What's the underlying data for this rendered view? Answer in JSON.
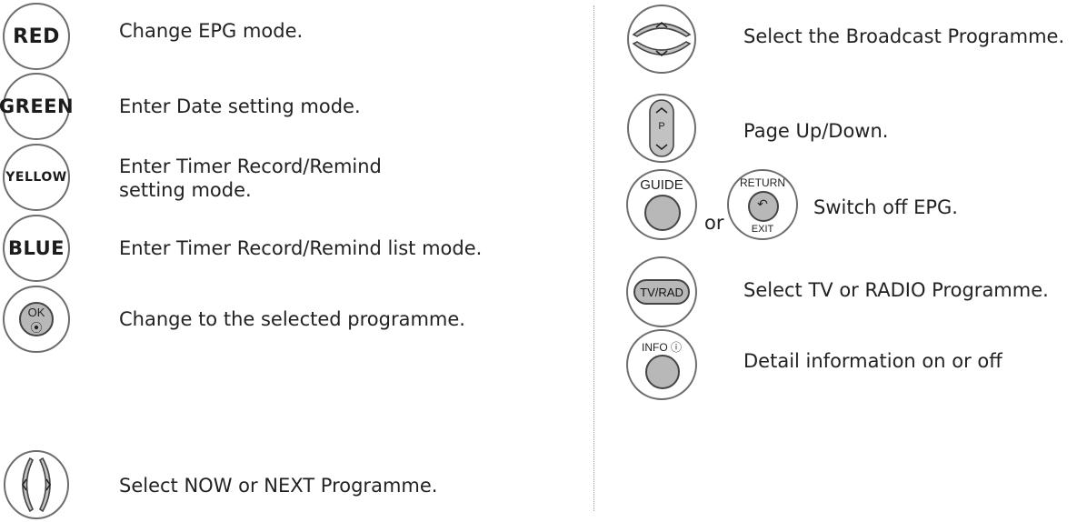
{
  "left": [
    {
      "button": "RED",
      "description": "Change EPG mode."
    },
    {
      "button": "GREEN",
      "description": "Enter Date setting mode."
    },
    {
      "button": "YELLOW",
      "description": "Enter Timer Record/Remind setting mode."
    },
    {
      "button": "BLUE",
      "description": "Enter Timer Record/Remind list mode."
    },
    {
      "button": "OK",
      "description": "Change to the selected programme."
    },
    {
      "button": "left-right-icon",
      "description": "Select NOW or NEXT Programme."
    }
  ],
  "right": [
    {
      "button": "up-down-icon",
      "description": "Select the Broadcast Programme."
    },
    {
      "button": "P",
      "description": "Page Up/Down."
    },
    {
      "button": "GUIDE",
      "or": "or",
      "button2": "RETURN",
      "button2_sub": "EXIT",
      "description": "Switch off EPG."
    },
    {
      "button": "TV/RAD",
      "description": "Select TV or RADIO Programme."
    },
    {
      "button": "INFO ⓘ",
      "description": "Detail information on or off"
    }
  ]
}
